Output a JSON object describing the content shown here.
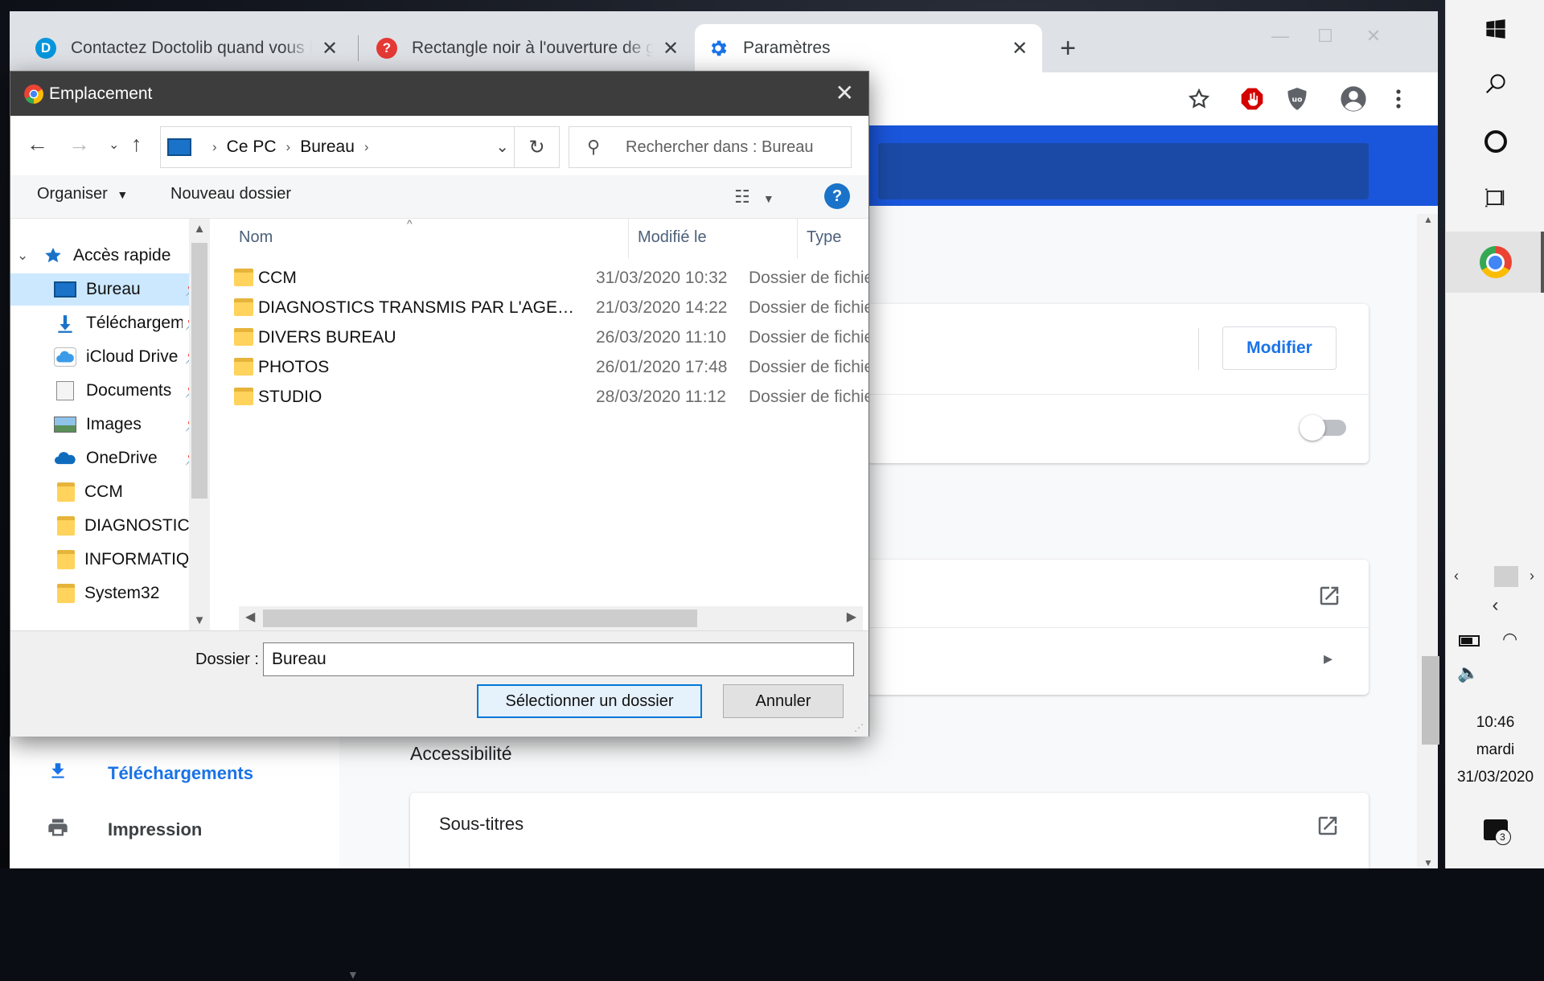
{
  "browser": {
    "tabs": [
      {
        "title": "Contactez Doctolib quand vous le",
        "favicon": "doctolib-icon",
        "active": false
      },
      {
        "title": "Rectangle noir à l'ouverture de g",
        "favicon": "question-icon",
        "active": false
      },
      {
        "title": "Paramètres",
        "favicon": "settings-gear-icon",
        "active": true
      }
    ],
    "new_tab": "+",
    "close_glyph": "✕"
  },
  "settings_page": {
    "modify_button": "Modifier",
    "accessibility_heading": "Accessibilité",
    "captions_row": "Sous-titres",
    "nav": [
      {
        "label": "Téléchargements",
        "icon": "download-icon"
      },
      {
        "label": "Impression",
        "icon": "printer-icon"
      }
    ]
  },
  "dialog": {
    "title": "Emplacement",
    "breadcrumb": [
      "Ce PC",
      "Bureau"
    ],
    "search_placeholder": "Rechercher dans : Bureau",
    "organize": "Organiser",
    "new_folder": "Nouveau dossier",
    "help": "?",
    "tree": [
      {
        "label": "Accès rapide",
        "icon": "star-icon",
        "level": 0,
        "expanded": true
      },
      {
        "label": "Bureau",
        "icon": "desktop-icon",
        "level": 1,
        "pinned": true,
        "selected": true
      },
      {
        "label": "Téléchargements",
        "icon": "download-icon",
        "level": 1,
        "pinned": true
      },
      {
        "label": "iCloud Drive",
        "icon": "icloud-icon",
        "level": 1,
        "pinned": true
      },
      {
        "label": "Documents",
        "icon": "documents-icon",
        "level": 1,
        "pinned": true
      },
      {
        "label": "Images",
        "icon": "images-icon",
        "level": 1,
        "pinned": true
      },
      {
        "label": "OneDrive",
        "icon": "onedrive-icon",
        "level": 1,
        "pinned": true
      },
      {
        "label": "CCM",
        "icon": "folder-icon",
        "level": 1
      },
      {
        "label": "DIAGNOSTICS TRANSMIS PAR L'AGENT IMMOBILIER",
        "icon": "folder-icon",
        "level": 1
      },
      {
        "label": "INFORMATIQUE",
        "icon": "folder-icon",
        "level": 1
      },
      {
        "label": "System32",
        "icon": "folder-icon",
        "level": 1
      }
    ],
    "columns": [
      "Nom",
      "Modifié le",
      "Type"
    ],
    "files": [
      {
        "name": "CCM",
        "modified": "31/03/2020 10:32",
        "type": "Dossier de fichiers"
      },
      {
        "name": "DIAGNOSTICS TRANSMIS PAR L'AGENT IMMOBILIER",
        "modified": "21/03/2020 14:22",
        "type": "Dossier de fichiers"
      },
      {
        "name": "DIVERS BUREAU",
        "modified": "26/03/2020 11:10",
        "type": "Dossier de fichiers"
      },
      {
        "name": "PHOTOS",
        "modified": "26/01/2020 17:48",
        "type": "Dossier de fichiers"
      },
      {
        "name": "STUDIO",
        "modified": "28/03/2020 11:12",
        "type": "Dossier de fichiers"
      }
    ],
    "folder_label": "Dossier :",
    "folder_value": "Bureau",
    "select_button": "Sélectionner un dossier",
    "cancel_button": "Annuler"
  },
  "taskbar": {
    "time": "10:46",
    "day": "mardi",
    "date": "31/03/2020",
    "notifications": "3"
  },
  "colors": {
    "accent": "#1a73e8",
    "settings_header": "#1a56db",
    "selection": "#cce8ff",
    "folder": "#ffd35c"
  }
}
